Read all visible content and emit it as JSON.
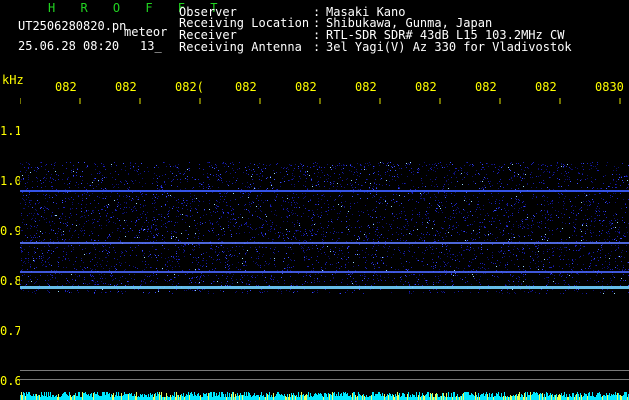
{
  "header": {
    "title": "H R O F F T",
    "filename": "UT2506280820.pn",
    "meteor_label": "meteor",
    "datetime": "25.06.28 08:20",
    "count": "13_"
  },
  "info": [
    {
      "label": "Observer",
      "value": "Masaki Kano"
    },
    {
      "label": "Receiving Location",
      "value": "Shibukawa, Gunma, Japan"
    },
    {
      "label": "Receiver",
      "value": "RTL-SDR SDR# 43dB L15 103.2MHz CW"
    },
    {
      "label": "Receiving Antenna",
      "value": "3el Yagi(V) Az 330 for Vladivostok"
    }
  ],
  "axis": {
    "y_unit": "kHz",
    "y_ticks": [
      "1.1",
      "1.0",
      "0.9",
      "0.8",
      "0.7",
      "0.6"
    ],
    "x_ticks": [
      "082",
      "082",
      "082(",
      "082",
      "082",
      "082",
      "082",
      "082",
      "082",
      "0830"
    ]
  },
  "colors": {
    "title": "#21d321",
    "text": "#ffffff",
    "axis": "#ffff00",
    "signal": "#2020ff",
    "signal_bright": "#6fd0ff",
    "noise_floor": "#00ffff"
  }
}
